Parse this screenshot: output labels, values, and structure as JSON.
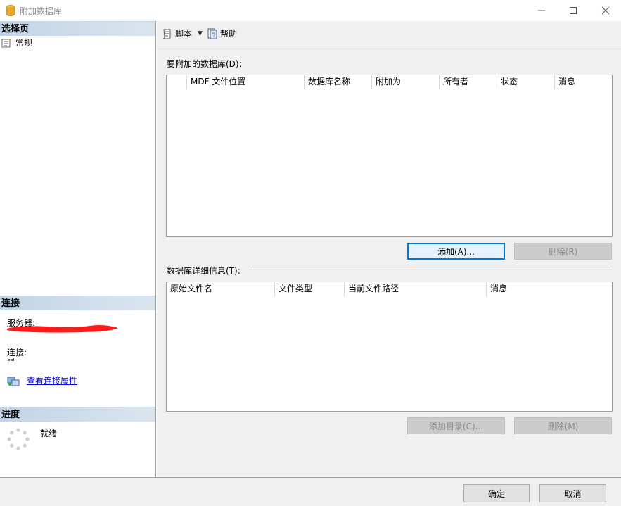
{
  "window": {
    "title": "附加数据库",
    "controls": [
      "minimize",
      "maximize",
      "close"
    ]
  },
  "left": {
    "select_page_header": "选择页",
    "pages": [
      {
        "label": "常规",
        "icon": "properties-page-icon"
      }
    ],
    "connection_header": "连接",
    "server_label": "服务器:",
    "server_value": "",
    "connection_label": "连接:",
    "connection_value": "sa",
    "view_props_link": "查看连接属性",
    "progress_header": "进度",
    "progress_status": "就绪"
  },
  "toolbar": {
    "script_label": "脚本",
    "help_label": "帮助"
  },
  "dbs_section": {
    "label": "要附加的数据库(D):",
    "columns": [
      "",
      "MDF 文件位置",
      "数据库名称",
      "附加为",
      "所有者",
      "状态",
      "消息"
    ],
    "rows": [],
    "add_button": "添加(A)...",
    "remove_button": "删除(R)"
  },
  "details_section": {
    "label": "数据库详细信息(T):",
    "columns": [
      "原始文件名",
      "文件类型",
      "当前文件路径",
      "消息"
    ],
    "rows": [],
    "add_catalog_button": "添加目录(C)...",
    "remove_button": "删除(M)"
  },
  "footer": {
    "ok_button": "确定",
    "cancel_button": "取消"
  }
}
